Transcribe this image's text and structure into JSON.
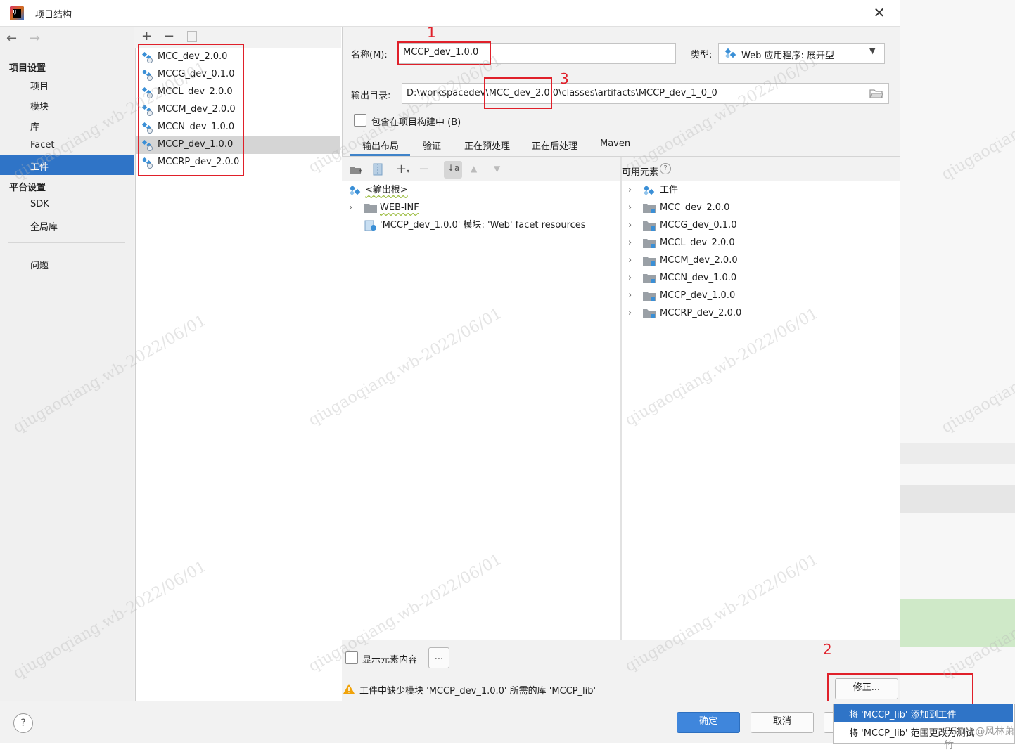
{
  "window": {
    "title": "项目结构"
  },
  "sidebar": {
    "project_settings_header": "项目设置",
    "project_items": [
      "项目",
      "模块",
      "库",
      "Facet",
      "工件"
    ],
    "platform_settings_header": "平台设置",
    "platform_items": [
      "SDK",
      "全局库"
    ],
    "problems": "问题"
  },
  "artifacts": {
    "items": [
      "MCC_dev_2.0.0",
      "MCCG_dev_0.1.0",
      "MCCL_dev_2.0.0",
      "MCCM_dev_2.0.0",
      "MCCN_dev_1.0.0",
      "MCCP_dev_1.0.0",
      "MCCRP_dev_2.0.0"
    ],
    "selected": "MCCP_dev_1.0.0"
  },
  "details": {
    "name_label": "名称(M):",
    "name_value": "MCCP_dev_1.0.0",
    "type_label": "类型:",
    "type_value": "Web 应用程序: 展开型",
    "output_label": "输出目录:",
    "output_value": "D:\\workspacedev\\MCC_dev_2.0.0\\classes\\artifacts\\MCCP_dev_1_0_0",
    "include_in_build": "包含在项目构建中 (B)",
    "tabs": [
      "输出布局",
      "验证",
      "正在预处理",
      "正在后处理",
      "Maven"
    ],
    "available_elements": "可用元素",
    "output_tree": {
      "root": "<输出根>",
      "web_inf": "WEB-INF",
      "facet_resources": "'MCCP_dev_1.0.0' 模块: 'Web' facet resources"
    },
    "available_tree": [
      "工件",
      "MCC_dev_2.0.0",
      "MCCG_dev_0.1.0",
      "MCCL_dev_2.0.0",
      "MCCM_dev_2.0.0",
      "MCCN_dev_1.0.0",
      "MCCP_dev_1.0.0",
      "MCCRP_dev_2.0.0"
    ],
    "show_contents": "显示元素内容",
    "ellipsis_btn": "...",
    "warning": "工件中缺少模块 'MCCP_dev_1.0.0' 所需的库 'MCCP_lib'",
    "fix_button": "修正..."
  },
  "footer": {
    "help": "?",
    "ok": "确定",
    "cancel": "取消"
  },
  "popup": {
    "items": [
      "将 'MCCP_lib' 添加到工件",
      "将 'MCCP_lib' 范围更改为测试"
    ]
  },
  "annotations": [
    "1",
    "2",
    "3"
  ],
  "watermark": "qiugaoqiang.wb-2022/06/01",
  "csdn_tag": "CSDN @风林萧竹",
  "colors": {
    "selection": "#2f74c7",
    "primary_button": "#3f86dc",
    "annotation_red": "#e0202a"
  }
}
